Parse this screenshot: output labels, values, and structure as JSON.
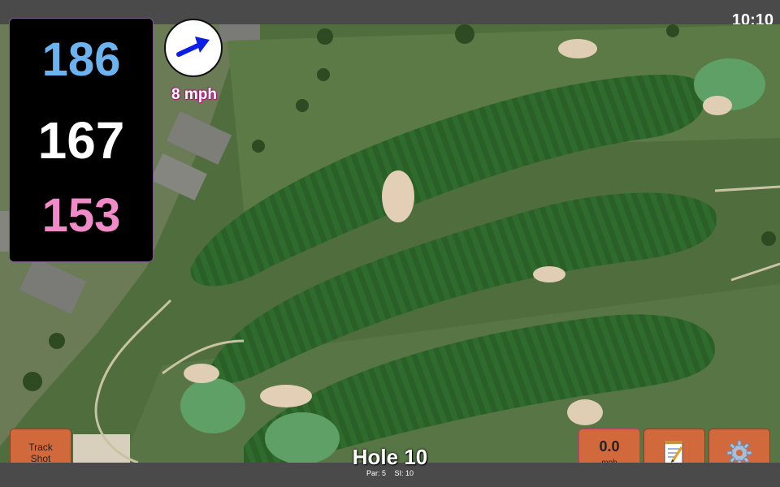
{
  "status": {
    "time": "10:10"
  },
  "distances": {
    "back": "186",
    "middle": "167",
    "front": "153"
  },
  "wind": {
    "speed_label": "8 mph",
    "direction_icon": "wind-arrow-icon"
  },
  "buttons": {
    "track_shot_line1": "Track",
    "track_shot_line2": "Shot",
    "speed_value": "0.0",
    "speed_unit": "mph",
    "notes_icon": "notepad-icon",
    "settings_icon": "gear-icon"
  },
  "hole": {
    "title": "Hole 10",
    "par": "Par: 5",
    "si": "SI: 10"
  },
  "colors": {
    "back": "#6bb3f0",
    "middle": "#ffffff",
    "front": "#f08ac8",
    "button": "#d2693c",
    "wind_arrow": "#0a1ee6"
  }
}
